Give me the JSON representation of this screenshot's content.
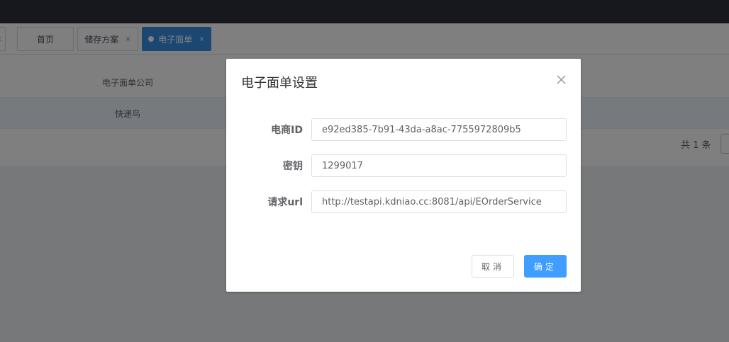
{
  "tags": [
    {
      "label": "",
      "close": "×"
    },
    {
      "label": "首页"
    },
    {
      "label": "储存方案",
      "close": "×"
    },
    {
      "label": "电子面单",
      "close": "×",
      "active": true
    }
  ],
  "table": {
    "header": "电子面单公司",
    "rows": [
      {
        "company": "快递鸟"
      }
    ]
  },
  "pager": {
    "total": "共 1 条"
  },
  "dialog": {
    "title": "电子面单设置",
    "fields": [
      {
        "label": "电商ID",
        "value": "e92ed385-7b91-43da-a8ac-7755972809b5"
      },
      {
        "label": "密钥",
        "value": "1299017"
      },
      {
        "label": "请求url",
        "value": "http://testapi.kdniao.cc:8081/api/EOrderService"
      }
    ],
    "cancel_label": "取消",
    "ok_label": "确定"
  },
  "colors": {
    "primary": "#409eff",
    "active_tag": "#3a8ee6",
    "topbar": "#2e303b",
    "row_highlight": "#ecf5ff"
  },
  "icons": {
    "dialog_close": "close-icon",
    "tag_close": "x-icon",
    "tag_active_dot": "dot-icon"
  }
}
